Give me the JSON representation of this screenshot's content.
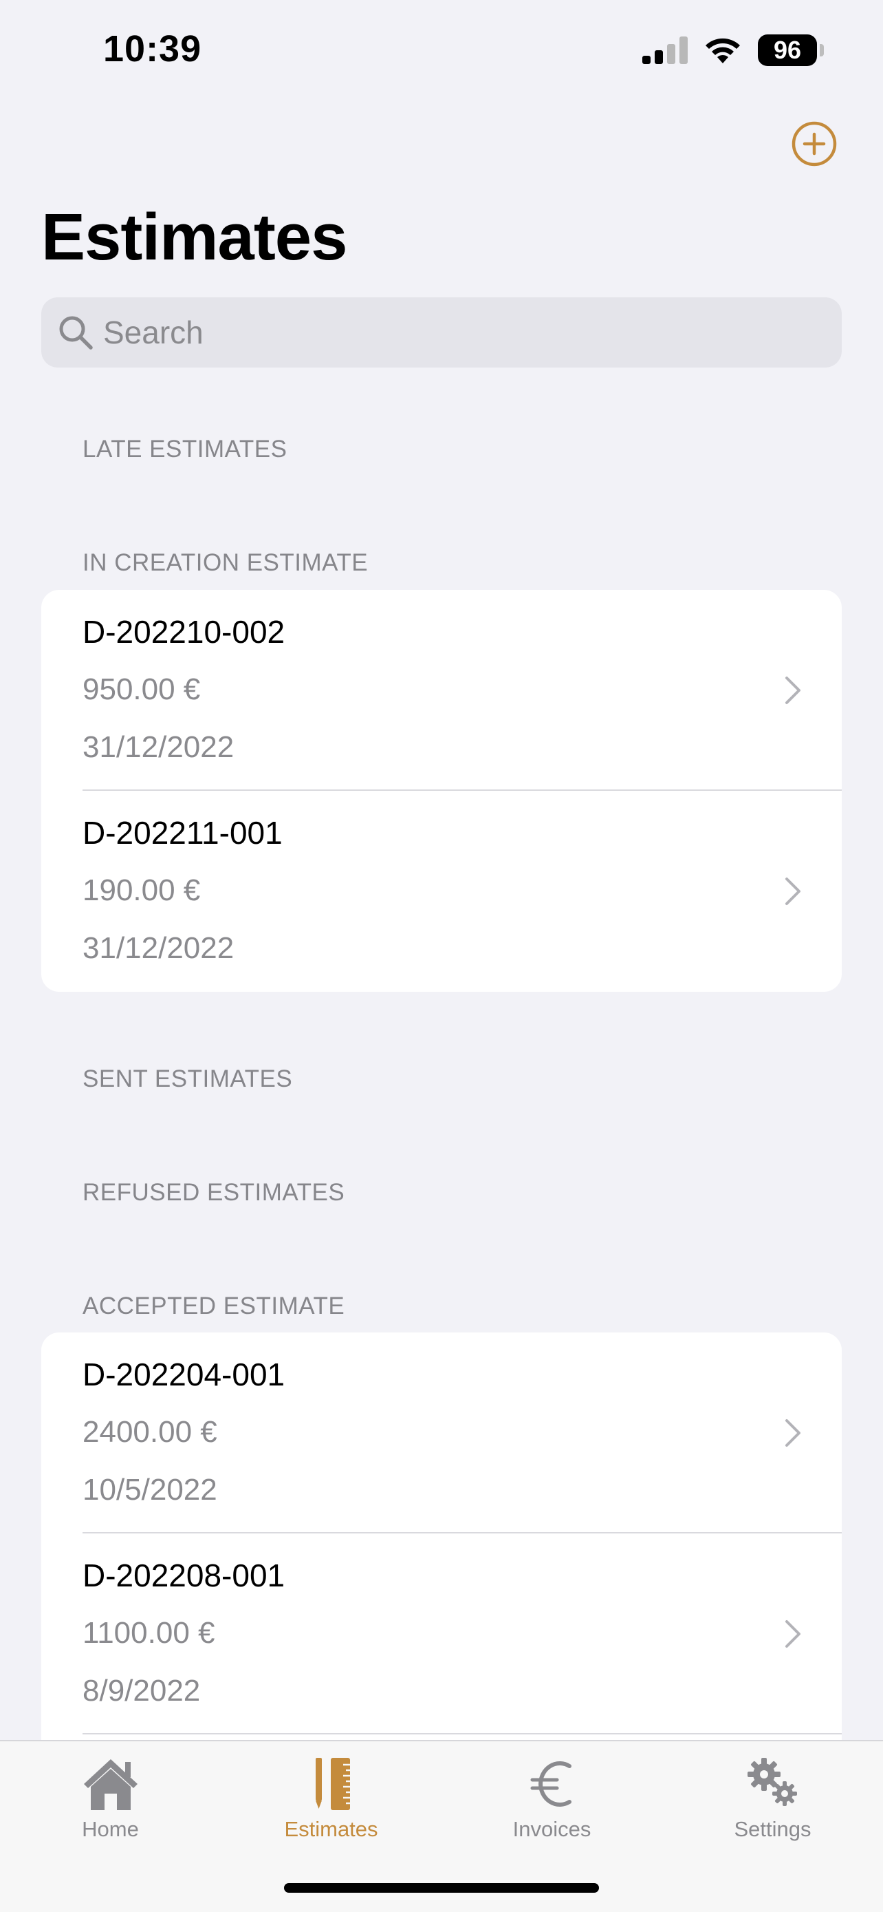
{
  "status_bar": {
    "time": "10:39",
    "battery": "96"
  },
  "header": {
    "title": "Estimates"
  },
  "search": {
    "placeholder": "Search"
  },
  "sections": {
    "late": "LATE ESTIMATES",
    "in_creation": "IN CREATION ESTIMATE",
    "sent": "SENT ESTIMATES",
    "refused": "REFUSED ESTIMATES",
    "accepted": "ACCEPTED ESTIMATE"
  },
  "in_creation_items": [
    {
      "id": "D-202210-002",
      "amount": "950.00 €",
      "date": "31/12/2022"
    },
    {
      "id": "D-202211-001",
      "amount": "190.00 €",
      "date": "31/12/2022"
    }
  ],
  "accepted_items": [
    {
      "id": "D-202204-001",
      "amount": "2400.00 €",
      "date": "10/5/2022"
    },
    {
      "id": "D-202208-001",
      "amount": "1100.00 €",
      "date": "8/9/2022"
    }
  ],
  "tabs": [
    {
      "label": "Home",
      "icon": "house-icon",
      "active": false
    },
    {
      "label": "Estimates",
      "icon": "ruler-pencil-icon",
      "active": true
    },
    {
      "label": "Invoices",
      "icon": "euro-icon",
      "active": false
    },
    {
      "label": "Settings",
      "icon": "gears-icon",
      "active": false
    }
  ],
  "colors": {
    "accent": "#c48b3c",
    "background": "#f2f2f7",
    "secondary_text": "#8a8a8e"
  }
}
